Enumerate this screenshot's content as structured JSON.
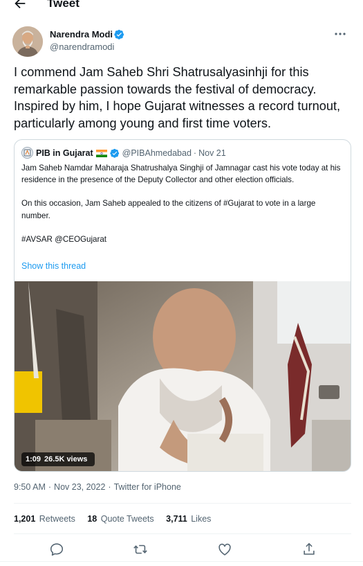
{
  "header": {
    "title": "Tweet",
    "back_icon": "arrow-left-icon"
  },
  "author": {
    "name": "Narendra Modi",
    "handle": "@narendramodi",
    "verified": true,
    "more_icon": "more-horizontal-icon"
  },
  "tweet": {
    "text": "I commend Jam Saheb Shri Shatrusalyasinhji for this remarkable passion towards the festival of democracy. Inspired by him, I hope Gujarat witnesses a record turnout, particularly among young and first time voters."
  },
  "quoted": {
    "name": "PIB in Gujarat",
    "flag_icon": "india-flag-icon",
    "verified": true,
    "handle": "@PIBAhmedabad",
    "separator": "·",
    "date": "Nov 21",
    "paragraphs": [
      "Jam Saheb Namdar Maharaja Shatrushalya Singhji of Jamnagar cast his vote today at his residence in the presence of the Deputy Collector and other election officials.",
      "On this occasion, Jam Saheb appealed to the citizens of #Gujarat to vote in a large number.",
      "#AVSAR @CEOGujarat"
    ],
    "show_thread": "Show this thread",
    "video": {
      "duration": "1:09",
      "views": "26.5K views"
    }
  },
  "meta": {
    "time": "9:50 AM",
    "dot": "·",
    "date": "Nov 23, 2022",
    "source": "Twitter for iPhone"
  },
  "stats": {
    "retweets_count": "1,201",
    "retweets_label": "Retweets",
    "quotes_count": "18",
    "quotes_label": "Quote Tweets",
    "likes_count": "3,711",
    "likes_label": "Likes"
  },
  "actions": {
    "reply_icon": "reply-icon",
    "retweet_icon": "retweet-icon",
    "like_icon": "heart-icon",
    "share_icon": "share-icon"
  },
  "colors": {
    "accent": "#1d9bf0",
    "text": "#0f1419",
    "secondary": "#536471",
    "border": "#cfd9de"
  }
}
